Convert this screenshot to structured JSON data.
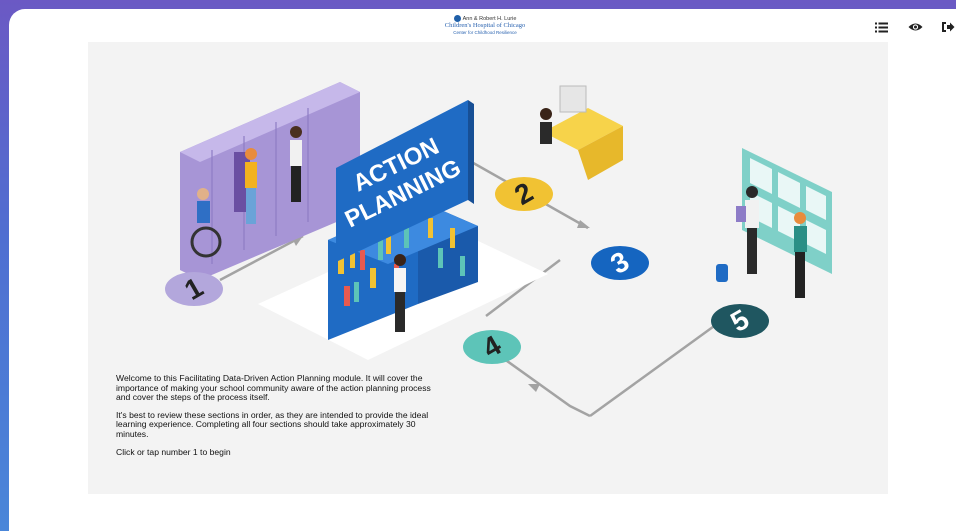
{
  "logo": {
    "line1": "Ann & Robert H. Lurie",
    "line2": "Children's Hospital of Chicago",
    "line3": "Center for Childhood Resilience"
  },
  "toolbar": {
    "menu_icon": "list-icon",
    "view_icon": "eye-icon",
    "exit_icon": "exit-icon"
  },
  "illustration": {
    "sign_line1": "ACTION",
    "sign_line2": "PLANNING",
    "steps": [
      "1",
      "2",
      "3",
      "4",
      "5"
    ],
    "colors": {
      "step1": "#b3a7dc",
      "step2": "#f1c233",
      "step3": "#1565c0",
      "step4": "#5dc4b8",
      "step5": "#1f5660"
    }
  },
  "intro": {
    "p1": "Welcome to this Facilitating Data-Driven Action Planning module. It will cover the importance of making your school community aware of the action planning process and cover the steps of the process itself.",
    "p2": "It's best to review these sections in order, as they are intended to provide the ideal learning experience. Completing all four sections should take approximately 30 minutes.",
    "p3": "Click or tap number 1 to begin"
  }
}
